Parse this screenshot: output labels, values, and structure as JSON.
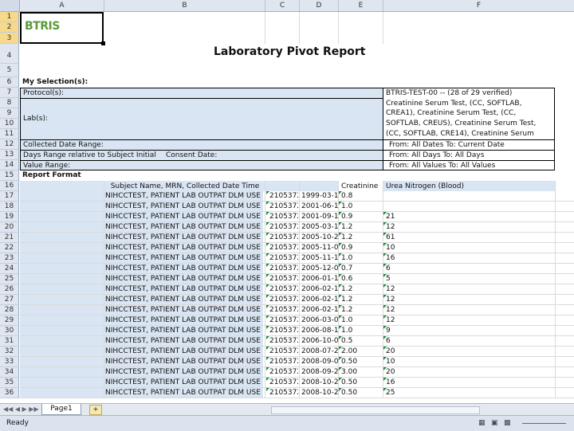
{
  "columns": [
    "A",
    "B",
    "C",
    "D",
    "E",
    "F"
  ],
  "logo_text": "BTRIS",
  "title": "Laboratory Pivot Report",
  "selection_heading": "My Selection(s):",
  "selection": {
    "protocols_label": "Protocol(s):",
    "protocols_value": "BTRIS-TEST-00 -- (28 of 29 verified)",
    "labs_label": "Lab(s):",
    "labs_lines": [
      "Creatinine Serum Test, (CC, SOFTLAB,",
      "CREA1), Creatinine Serum Test, (CC,",
      "SOFTLAB, CREUS), Creatinine Serum Test,",
      "(CC, SOFTLAB, CRE14), Creatinine Serum"
    ],
    "date_label": "Collected Date Range:",
    "date_value": "From: All Dates To: Current Date",
    "days_label": "Days Range relative to Subject Initial",
    "days_label2": "Consent Date:",
    "days_value": "From: All Days To: All Days",
    "value_label": "Value Range:",
    "value_value": "From: All Values To: All Values"
  },
  "report_format_label": "Report Format",
  "table_headers": {
    "name": "Subject Name, MRN, Collected Date Time",
    "creatinine": "Creatinine",
    "urea": "Urea Nitrogen (Blood)"
  },
  "rows": [
    {
      "name": "NIHCCTEST, PATIENT LAB OUTPAT DLM USE ONLY",
      "mrn": "2105372",
      "date": "1999-03-18",
      "creat": "0.8",
      "urea": ""
    },
    {
      "name": "NIHCCTEST, PATIENT LAB OUTPAT DLM USE ONLY",
      "mrn": "2105372",
      "date": "2001-06-16",
      "creat": "1.0",
      "urea": ""
    },
    {
      "name": "NIHCCTEST, PATIENT LAB OUTPAT DLM USE ONLY",
      "mrn": "2105372",
      "date": "2001-09-10",
      "creat": "0.9",
      "urea": "21"
    },
    {
      "name": "NIHCCTEST, PATIENT LAB OUTPAT DLM USE ONLY",
      "mrn": "2105372",
      "date": "2005-03-18",
      "creat": "1.2",
      "urea": "12"
    },
    {
      "name": "NIHCCTEST, PATIENT LAB OUTPAT DLM USE ONLY",
      "mrn": "2105372",
      "date": "2005-10-22",
      "creat": "1.2",
      "urea": "61"
    },
    {
      "name": "NIHCCTEST, PATIENT LAB OUTPAT DLM USE ONLY",
      "mrn": "2105372",
      "date": "2005-11-01",
      "creat": "0.9",
      "urea": "10"
    },
    {
      "name": "NIHCCTEST, PATIENT LAB OUTPAT DLM USE ONLY",
      "mrn": "2105372",
      "date": "2005-11-18",
      "creat": "1.0",
      "urea": "16"
    },
    {
      "name": "NIHCCTEST, PATIENT LAB OUTPAT DLM USE ONLY",
      "mrn": "2105372",
      "date": "2005-12-07",
      "creat": "0.7",
      "urea": "6"
    },
    {
      "name": "NIHCCTEST, PATIENT LAB OUTPAT DLM USE ONLY",
      "mrn": "2105372",
      "date": "2006-01-10",
      "creat": "0.6",
      "urea": "5"
    },
    {
      "name": "NIHCCTEST, PATIENT LAB OUTPAT DLM USE ONLY",
      "mrn": "2105372",
      "date": "2006-02-12",
      "creat": "1.2",
      "urea": "12"
    },
    {
      "name": "NIHCCTEST, PATIENT LAB OUTPAT DLM USE ONLY",
      "mrn": "2105372",
      "date": "2006-02-15",
      "creat": "1.2",
      "urea": "12"
    },
    {
      "name": "NIHCCTEST, PATIENT LAB OUTPAT DLM USE ONLY",
      "mrn": "2105372",
      "date": "2006-02-17",
      "creat": "1.2",
      "urea": "12"
    },
    {
      "name": "NIHCCTEST, PATIENT LAB OUTPAT DLM USE ONLY",
      "mrn": "2105372",
      "date": "2006-03-01",
      "creat": "1.0",
      "urea": "12"
    },
    {
      "name": "NIHCCTEST, PATIENT LAB OUTPAT DLM USE ONLY",
      "mrn": "2105372",
      "date": "2006-08-10",
      "creat": "1.0",
      "urea": "9"
    },
    {
      "name": "NIHCCTEST, PATIENT LAB OUTPAT DLM USE ONLY",
      "mrn": "2105372",
      "date": "2006-10-03",
      "creat": "0.5",
      "urea": "6"
    },
    {
      "name": "NIHCCTEST, PATIENT LAB OUTPAT DLM USE ONLY",
      "mrn": "2105372",
      "date": "2008-07-29",
      "creat": "2.00",
      "urea": "20"
    },
    {
      "name": "NIHCCTEST, PATIENT LAB OUTPAT DLM USE ONLY",
      "mrn": "2105372",
      "date": "2008-09-05",
      "creat": "0.50",
      "urea": "10"
    },
    {
      "name": "NIHCCTEST, PATIENT LAB OUTPAT DLM USE ONLY",
      "mrn": "2105372",
      "date": "2008-09-24",
      "creat": "3.00",
      "urea": "20"
    },
    {
      "name": "NIHCCTEST, PATIENT LAB OUTPAT DLM USE ONLY",
      "mrn": "2105372",
      "date": "2008-10-26",
      "creat": "0.50",
      "urea": "16"
    },
    {
      "name": "NIHCCTEST, PATIENT LAB OUTPAT DLM USE ONLY",
      "mrn": "2105372",
      "date": "2008-10-26",
      "creat": "0.50",
      "urea": "25"
    }
  ],
  "sheet_tab": "Page1",
  "status": "Ready",
  "colors": {
    "header_bg": "#dfe6ef",
    "blue_fill": "#d9e5f2",
    "selected_row": "#f7d98b",
    "logo_green": "#5b9b3b",
    "error_triangle": "#1a8b3a"
  }
}
